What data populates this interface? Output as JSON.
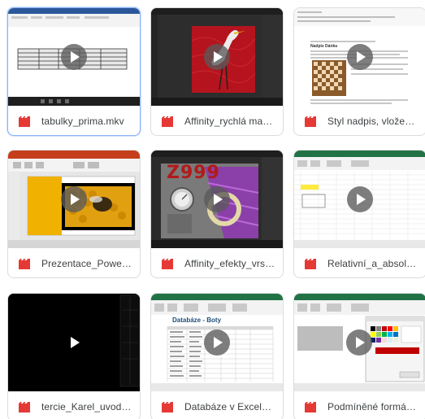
{
  "files": [
    {
      "title": "tabulky_prima.mkv"
    },
    {
      "title": "Affinity_rychlá mask..."
    },
    {
      "title": "Styl nadpis, vložení ..."
    },
    {
      "title": "Prezentace_Powerp..."
    },
    {
      "title": "Affinity_efekty_vrstv..."
    },
    {
      "title": "Relativní_a_absolut..."
    },
    {
      "title": "tercie_Karel_uvod.m..."
    },
    {
      "title": "Databáze v Excelu...."
    },
    {
      "title": "Podmíněné formáto..."
    }
  ],
  "thumbs": {
    "doc_heading": "Nadpis Dánku",
    "affinity_text": "Z999",
    "excel_heading": "Databáze - Boty"
  },
  "icon": "video-file-icon",
  "colors": {
    "film_icon": "#e53935",
    "play_bg": "#5a5a5a",
    "border": "#dadce0",
    "selected_border": "#8ab4f8"
  }
}
